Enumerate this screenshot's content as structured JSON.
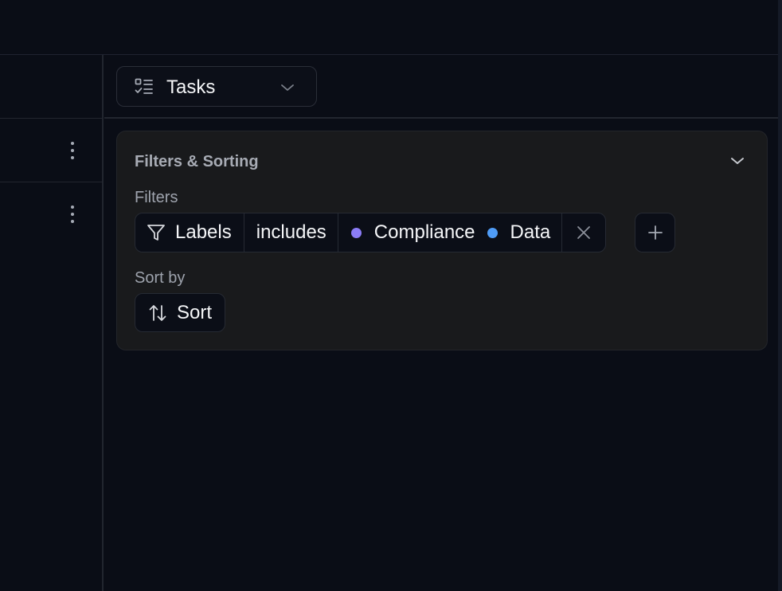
{
  "view_selector": {
    "label": "Tasks",
    "icon": "tasks-icon"
  },
  "panel": {
    "title": "Filters & Sorting",
    "filters_label": "Filters",
    "filter": {
      "field": "Labels",
      "operator": "includes",
      "values": [
        {
          "label": "Compliance",
          "color": "#8b7cf6"
        },
        {
          "label": "Data",
          "color": "#4f9cf7"
        }
      ]
    },
    "sort_label": "Sort by",
    "sort_button_label": "Sort"
  },
  "colors": {
    "background": "#0a0d16",
    "panel": "#191a1c",
    "chip": "#0b0e17",
    "border": "#262a33"
  }
}
